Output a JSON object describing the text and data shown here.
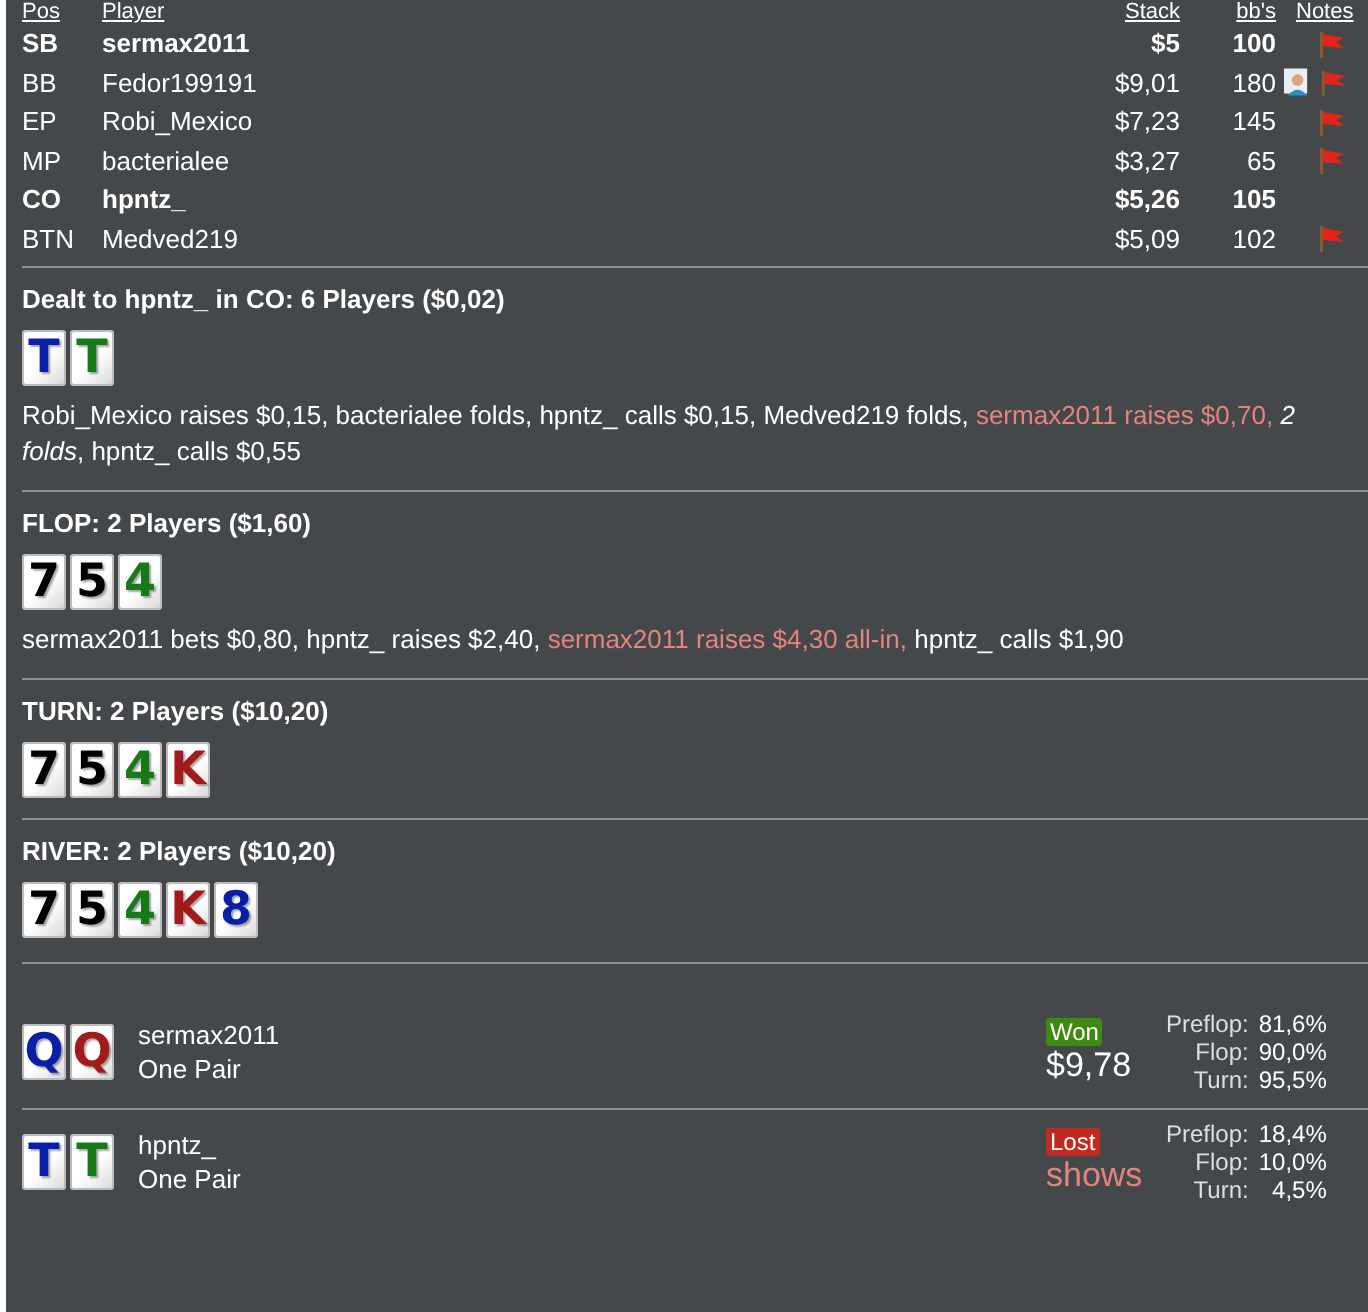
{
  "columns": [
    "Pos",
    "Player",
    "Stack",
    "bb's",
    "Notes"
  ],
  "players": [
    {
      "pos": "SB",
      "name": "sermax2011",
      "stack": "$5",
      "bbs": "100",
      "bold": true,
      "avatar": false,
      "flag": true
    },
    {
      "pos": "BB",
      "name": "Fedor199191",
      "stack": "$9,01",
      "bbs": "180",
      "bold": false,
      "avatar": true,
      "flag": true
    },
    {
      "pos": "EP",
      "name": "Robi_Mexico",
      "stack": "$7,23",
      "bbs": "145",
      "bold": false,
      "avatar": false,
      "flag": true
    },
    {
      "pos": "MP",
      "name": "bacterialee",
      "stack": "$3,27",
      "bbs": "65",
      "bold": false,
      "avatar": false,
      "flag": true
    },
    {
      "pos": "CO",
      "name": "hpntz_",
      "stack": "$5,26",
      "bbs": "105",
      "bold": true,
      "avatar": false,
      "flag": false
    },
    {
      "pos": "BTN",
      "name": "Medved219",
      "stack": "$5,09",
      "bbs": "102",
      "bold": false,
      "avatar": false,
      "flag": true
    }
  ],
  "streets": [
    {
      "title": "Dealt to hpntz_ in CO: 6 Players ($0,02)",
      "cards": [
        {
          "rank": "T",
          "color": "#0a1fa8"
        },
        {
          "rank": "T",
          "color": "#17791a"
        }
      ],
      "actions": [
        {
          "kind": "plain",
          "text": "Robi_Mexico raises $0,15, bacterialee folds, hpntz_ calls $0,15, Medved219 folds, "
        },
        {
          "kind": "accent",
          "text": "sermax2011 raises $0,70, "
        },
        {
          "kind": "italic",
          "text": "2 folds"
        },
        {
          "kind": "plain",
          "text": ", hpntz_ calls $0,55"
        }
      ]
    },
    {
      "title": "FLOP: 2 Players ($1,60)",
      "cards": [
        {
          "rank": "7",
          "color": "#000000"
        },
        {
          "rank": "5",
          "color": "#000000"
        },
        {
          "rank": "4",
          "color": "#17791a"
        }
      ],
      "actions": [
        {
          "kind": "plain",
          "text": "sermax2011 bets $0,80, hpntz_ raises $2,40, "
        },
        {
          "kind": "accent",
          "text": "sermax2011 raises $4,30 all-in, "
        },
        {
          "kind": "plain",
          "text": "hpntz_ calls $1,90"
        }
      ]
    },
    {
      "title": "TURN: 2 Players ($10,20)",
      "cards": [
        {
          "rank": "7",
          "color": "#000000"
        },
        {
          "rank": "5",
          "color": "#000000"
        },
        {
          "rank": "4",
          "color": "#17791a"
        },
        {
          "rank": "K",
          "color": "#a31a1a"
        }
      ]
    },
    {
      "title": "RIVER: 2 Players ($10,20)",
      "cards": [
        {
          "rank": "7",
          "color": "#000000"
        },
        {
          "rank": "5",
          "color": "#000000"
        },
        {
          "rank": "4",
          "color": "#17791a"
        },
        {
          "rank": "K",
          "color": "#a31a1a"
        },
        {
          "rank": "8",
          "color": "#0a1fa8"
        }
      ]
    }
  ],
  "showdown": [
    {
      "cards": [
        {
          "rank": "Q",
          "color": "#0a1fa8"
        },
        {
          "rank": "Q",
          "color": "#a31a1a"
        }
      ],
      "name": "sermax2011",
      "hand": "One Pair",
      "kind": "won",
      "badge": "Won",
      "amount": "$9,78",
      "equity": [
        {
          "label": "Preflop:",
          "value": "81,6%"
        },
        {
          "label": "Flop:",
          "value": "90,0%"
        },
        {
          "label": "Turn:",
          "value": "95,5%"
        }
      ]
    },
    {
      "cards": [
        {
          "rank": "T",
          "color": "#0a1fa8"
        },
        {
          "rank": "T",
          "color": "#17791a"
        }
      ],
      "name": "hpntz_",
      "hand": "One Pair",
      "kind": "lost",
      "badge": "Lost",
      "amount": "shows",
      "equity": [
        {
          "label": "Preflop:",
          "value": "18,4%"
        },
        {
          "label": "Flop:",
          "value": "10,0%"
        },
        {
          "label": "Turn:",
          "value": "4,5%"
        }
      ]
    }
  ]
}
